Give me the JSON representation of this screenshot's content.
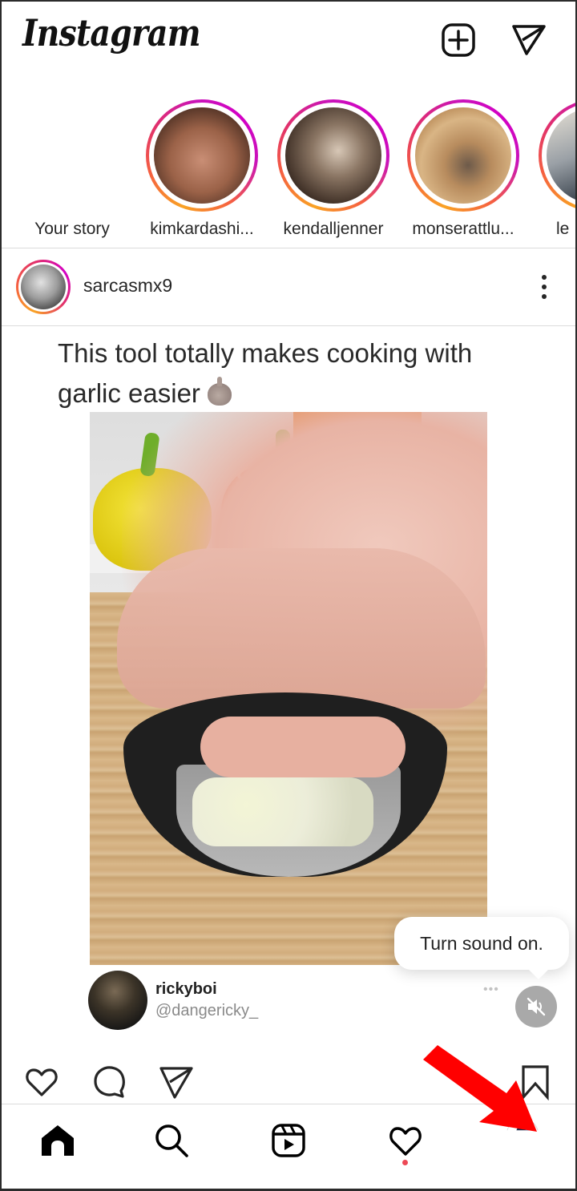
{
  "app": {
    "logo_text": "Instagram",
    "header_icons": [
      "new-post-icon",
      "direct-message-icon"
    ]
  },
  "stories": [
    {
      "username": "Your story",
      "has_ring": false
    },
    {
      "username": "kimkardashi...",
      "has_ring": true
    },
    {
      "username": "kendalljenner",
      "has_ring": true
    },
    {
      "username": "monserattlu...",
      "has_ring": true
    },
    {
      "username": "le",
      "has_ring": true
    }
  ],
  "post": {
    "username": "sarcasmx9",
    "media": {
      "caption_line1": "This tool totally makes cooking with",
      "caption_line2": "garlic easier",
      "caption_emoji": "garlic-emoji",
      "embedded_author_name": "rickyboi",
      "embedded_author_handle": "@dangericky_",
      "embedded_more": "•••"
    },
    "tooltip": "Turn sound on.",
    "sound_state": "muted",
    "actions": [
      "like-icon",
      "comment-icon",
      "share-icon",
      "save-icon"
    ]
  },
  "bottom_nav": {
    "items": [
      "home",
      "search",
      "reels",
      "activity",
      "profile"
    ],
    "active": "home",
    "activity_notification": true
  },
  "colors": {
    "story_ring_start": "#f9a224",
    "story_ring_end": "#d300c5",
    "notification_dot": "#ed4956",
    "annotation_arrow": "#ff0000"
  }
}
